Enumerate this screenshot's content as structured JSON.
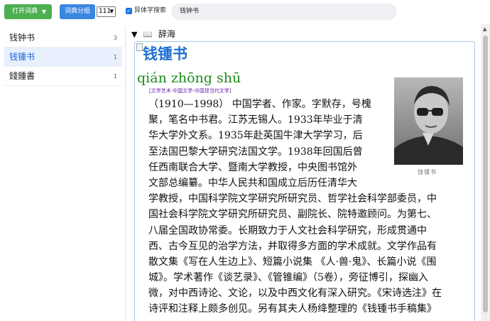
{
  "toolbar": {
    "open_dict_label": "打开词典",
    "dict_group_label": "词典分组",
    "group_select_value": "111",
    "variant_search_label": "异体字搜索",
    "search_value": "钱钟书"
  },
  "sidebar": {
    "items": [
      {
        "label": "钱钟书",
        "count": "3"
      },
      {
        "label": "钱锺书",
        "count": "1"
      },
      {
        "label": "錢鍾書",
        "count": "1"
      }
    ]
  },
  "main": {
    "dict_name": "辞海",
    "entry": {
      "headword": "钱锺书",
      "pinyin": "qián zhōng shū",
      "tags": "[文学艺术-中国文学-中国现当代文学]",
      "photo_caption": "钱锺书",
      "lines": [
        "（1910—1998） 中国学者、作家。字默存，号槐",
        "聚，笔名中书君。江苏无锡人。1933年毕业于清",
        "华大学外文系。1935年赴英国牛津大学学习，后",
        "至法国巴黎大学研究法国文学。1938年回国后曾",
        "任西南联合大学、暨南大学教授，中央图书馆外",
        "文部总编纂。中华人民共和国成立后历任清华大",
        "学教授，中国科学院文学研究所研究员、哲学社会科学部委员，中",
        "国社会科学院文学研究所研究员、副院长、院特邀顾问。为第七、",
        "八届全国政协常委。长期致力于人文社会科学研究，形成贯通中",
        "西、古今互见的治学方法，并取得多方面的学术成就。文学作品有",
        "散文集《写在人生边上》、短篇小说集 《人·兽·鬼》、长篇小说《围",
        "城》。学术著作《谈艺录》、《管锥编》（5卷），旁征博引，探幽入",
        "微，对中西诗论、文论，以及中西文化有深入研究。《宋诗选注》在",
        "诗评和注释上颇多创见。另有其夫人杨绛整理的《钱锺书手稿集》"
      ]
    }
  }
}
